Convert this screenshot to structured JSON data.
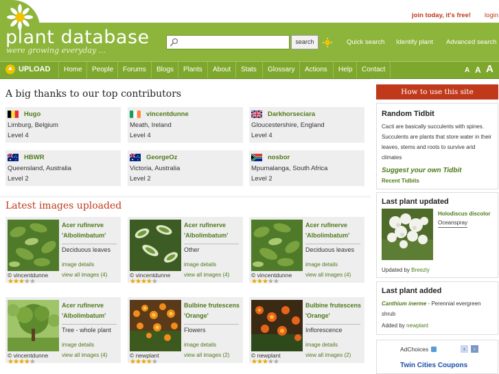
{
  "header": {
    "join_label": "join today, it's free!",
    "login_label": "login",
    "logo_text": "plant database",
    "tagline": "were growing everyday ...",
    "search_button": "search",
    "search_placeholder": "",
    "links": [
      "Quick search",
      "Identify plant",
      "Advanced search"
    ],
    "accent_color": "#8db43b",
    "nav_color": "#7ea72e",
    "brand_red": "#c0391b"
  },
  "nav": {
    "upload_label": "UPLOAD",
    "items": [
      "Home",
      "People",
      "Forums",
      "Blogs",
      "Plants",
      "About",
      "Stats",
      "Glossary",
      "Actions",
      "Help",
      "Contact"
    ],
    "font_sizes": [
      "A",
      "A",
      "A"
    ]
  },
  "contributors": {
    "title": "A big thanks to our top contributors",
    "items": [
      {
        "name": "Hugo",
        "location": "Limburg, Belgium",
        "level": "Level 4",
        "flag": "belgium-flag"
      },
      {
        "name": "vincentdunne",
        "location": "Meath, Ireland",
        "level": "Level 4",
        "flag": "ireland-flag"
      },
      {
        "name": "Darkhorseciara",
        "location": "Gloucestershire, England",
        "level": "Level 4",
        "flag": "uk-flag"
      },
      {
        "name": "HBWR",
        "location": "Queensland, Australia",
        "level": "Level 2",
        "flag": "australia-flag"
      },
      {
        "name": "GeorgeOz",
        "location": "Victoria, Australia",
        "level": "Level 2",
        "flag": "australia-flag"
      },
      {
        "name": "nosbor",
        "location": "Mpumalanga, South Africa",
        "level": "Level 2",
        "flag": "south-africa-flag"
      }
    ]
  },
  "latest": {
    "title": "Latest images uploaded",
    "items": [
      {
        "name1": "Acer rufinerve",
        "name2": "'Albolimbatum'",
        "type": "Deciduous leaves",
        "details": "image details",
        "viewall": "view all images (4)",
        "user": "© vincentdunne",
        "rating": 3,
        "theme": "green"
      },
      {
        "name1": "Acer rufinerve",
        "name2": "'Albolimbatum'",
        "type": "Other",
        "details": "image details",
        "viewall": "view all images (4)",
        "user": "© vincentdunne",
        "rating": 3.5,
        "theme": "variegated"
      },
      {
        "name1": "Acer rufinerve",
        "name2": "'Albolimbatum'",
        "type": "Deciduous leaves",
        "details": "image details",
        "viewall": "view all images (4)",
        "user": "© vincentdunne",
        "rating": 3,
        "theme": "green"
      },
      {
        "name1": "Acer rufinerve",
        "name2": "'Albolimbatum'",
        "type": "Tree - whole plant",
        "details": "image details",
        "viewall": "view all images (4)",
        "user": "© vincentdunne",
        "rating": 3.5,
        "theme": "tree"
      },
      {
        "name1": "Bulbine frutescens",
        "name2": "'Orange'",
        "type": "Flowers",
        "details": "image details",
        "viewall": "view all images (2)",
        "user": "© newplant",
        "rating": 3.5,
        "theme": "orange"
      },
      {
        "name1": "Bulbine frutescens",
        "name2": "'Orange'",
        "type": "Inflorescence",
        "details": "image details",
        "viewall": "view all images (2)",
        "user": "© newplant",
        "rating": 3,
        "theme": "orange2"
      }
    ]
  },
  "sidebar": {
    "how_to": "How to use this site",
    "tidbit_title": "Random Tidbit",
    "tidbit_lines": [
      "Cacti are basically succulents with spines.",
      "Succulents are plants that store water in their",
      "leaves, stems and roots to survive arid",
      "climates"
    ],
    "suggest_label": "Suggest your own Tidbit",
    "recent_label": "Recent Tidbits",
    "updated_title": "Last plant updated",
    "updated_name": "Holodiscus discolor",
    "updated_common": "Oceanspray",
    "updated_by_prefix": "Updated by",
    "updated_by_user": "Breezly",
    "added_title": "Last plant added",
    "added_name": "Canthium inerme",
    "added_desc": " - Perennial evergreen",
    "added_desc2": "shrub",
    "added_by_prefix": "Added by",
    "added_by_user": "newplant",
    "ad_label": "AdChoices",
    "ad_link": "Twin Cities Coupons"
  }
}
